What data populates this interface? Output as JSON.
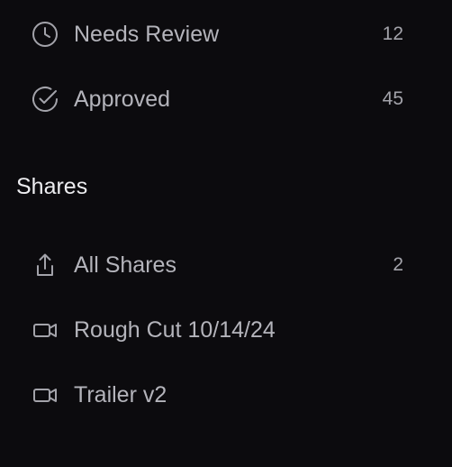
{
  "review_items": [
    {
      "label": "Needs Review",
      "count": "12",
      "icon": "clock-icon"
    },
    {
      "label": "Approved",
      "count": "45",
      "icon": "check-circle-icon"
    }
  ],
  "shares": {
    "heading": "Shares",
    "items": [
      {
        "label": "All Shares",
        "count": "2",
        "icon": "share-upload-icon"
      },
      {
        "label": "Rough Cut 10/14/24",
        "count": "",
        "icon": "video-camera-icon"
      },
      {
        "label": "Trailer v2",
        "count": "",
        "icon": "video-camera-icon"
      }
    ]
  }
}
